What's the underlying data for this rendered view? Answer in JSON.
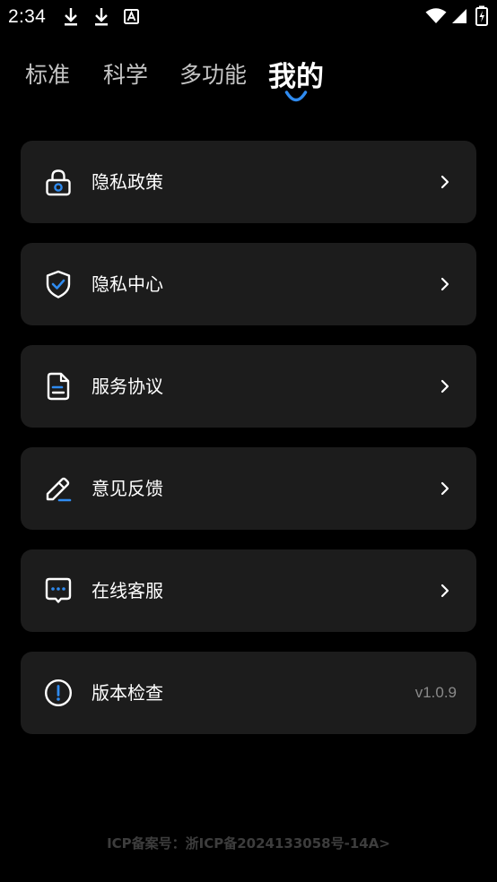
{
  "status_bar": {
    "time": "2:34",
    "left_icons": [
      "download-icon",
      "download-icon",
      "a-letter-icon"
    ],
    "right_icons": [
      "wifi-icon",
      "signal-icon",
      "battery-icon"
    ]
  },
  "tabs": [
    {
      "label": "标准",
      "active": false
    },
    {
      "label": "科学",
      "active": false
    },
    {
      "label": "多功能",
      "active": false
    },
    {
      "label": "我的",
      "active": true
    }
  ],
  "menu": [
    {
      "label": "隐私政策",
      "icon": "lock-icon",
      "trailing": "chevron-right-icon"
    },
    {
      "label": "隐私中心",
      "icon": "shield-check-icon",
      "trailing": "chevron-right-icon"
    },
    {
      "label": "服务协议",
      "icon": "document-icon",
      "trailing": "chevron-right-icon"
    },
    {
      "label": "意见反馈",
      "icon": "pencil-icon",
      "trailing": "chevron-right-icon"
    },
    {
      "label": "在线客服",
      "icon": "chat-icon",
      "trailing": "chevron-right-icon"
    },
    {
      "label": "版本检查",
      "icon": "exclamation-icon",
      "value": "v1.0.9"
    }
  ],
  "footer": {
    "icp": "ICP备案号：浙ICP备2024133058号-14A>"
  },
  "colors": {
    "background": "#000000",
    "card": "#1c1c1c",
    "accent": "#2f8bf0",
    "text": "#ffffff",
    "muted": "#8a8a8a"
  }
}
